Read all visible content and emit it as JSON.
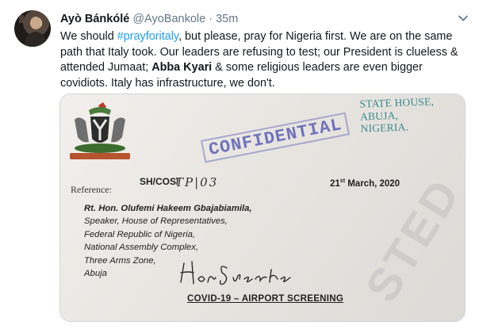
{
  "tweet": {
    "author_name": "Ayò Bánkólé",
    "handle": "@AyoBankole",
    "separator": "·",
    "time": "35m",
    "text_parts": [
      "We should ",
      "#prayforitaly",
      ", but please, pray for Nigeria first. We are on the same path that Italy took. Our leaders are refusing to test; our President is clueless & attended Jumaat; ",
      "Abba Kyari",
      " & some religious leaders are even bigger covidiots. Italy has infrastructure, we don't."
    ]
  },
  "document": {
    "state_house_lines": [
      "STATE HOUSE,",
      "ABUJA,",
      "NIGERIA."
    ],
    "stamp": "CONFIDENTIAL",
    "reference_label": "Reference:",
    "reference_code": "SH/COS/",
    "reference_handwritten": "TP|03",
    "date": "21",
    "date_suffix": "st",
    "date_rest": " March, 2020",
    "addressee_lines": [
      "Rt. Hon. Olufemi Hakeem Gbajabiamila,",
      "Speaker, House of Representatives,",
      "Federal Republic of Nigeria,",
      "National Assembly Complex,",
      "Three Arms Zone,",
      "Abuja"
    ],
    "signature": "Hon Speaker",
    "subject": "COVID-19 – AIRPORT SCREENING",
    "watermark": "STED"
  },
  "colors": {
    "hashtag": "#1da1f2",
    "secondary_text": "#657786",
    "stamp": "#5b5fb5",
    "state_house": "#3a8a8c"
  },
  "icons": {
    "menu": "chevron-down-icon",
    "avatar": "avatar",
    "coat_of_arms": "coat-of-arms-icon"
  }
}
